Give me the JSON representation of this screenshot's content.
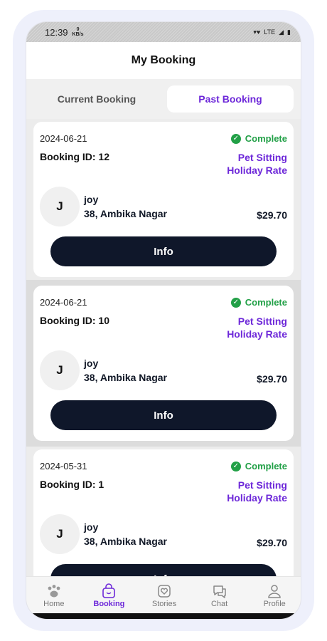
{
  "status_bar": {
    "time": "12:39",
    "netspeed_value": "0",
    "netspeed_unit": "KB/s",
    "network": "LTE"
  },
  "header": {
    "title": "My Booking"
  },
  "tabs": [
    {
      "label": "Current Booking",
      "active": false
    },
    {
      "label": "Past Booking",
      "active": true
    }
  ],
  "bookings": [
    {
      "date": "2024-06-21",
      "status": "Complete",
      "booking_id": "Booking ID: 12",
      "service_line1": "Pet Sitting",
      "service_line2": "Holiday Rate",
      "avatar_initial": "J",
      "name": "joy",
      "address": "38, Ambika Nagar",
      "price": "$29.70",
      "button": "Info"
    },
    {
      "date": "2024-06-21",
      "status": "Complete",
      "booking_id": "Booking ID: 10",
      "service_line1": "Pet Sitting",
      "service_line2": "Holiday Rate",
      "avatar_initial": "J",
      "name": "joy",
      "address": "38, Ambika Nagar",
      "price": "$29.70",
      "button": "Info"
    },
    {
      "date": "2024-05-31",
      "status": "Complete",
      "booking_id": "Booking ID: 1",
      "service_line1": "Pet Sitting",
      "service_line2": "Holiday Rate",
      "avatar_initial": "J",
      "name": "joy",
      "address": "38, Ambika Nagar",
      "price": "$29.70",
      "button": "Info"
    }
  ],
  "nav": [
    {
      "label": "Home",
      "icon": "paw-icon"
    },
    {
      "label": "Booking",
      "icon": "bag-icon",
      "active": true
    },
    {
      "label": "Stories",
      "icon": "heart-icon"
    },
    {
      "label": "Chat",
      "icon": "chat-icon"
    },
    {
      "label": "Profile",
      "icon": "person-icon"
    }
  ],
  "colors": {
    "accent": "#6d28d9",
    "success": "#22a047",
    "button": "#0f172a"
  }
}
